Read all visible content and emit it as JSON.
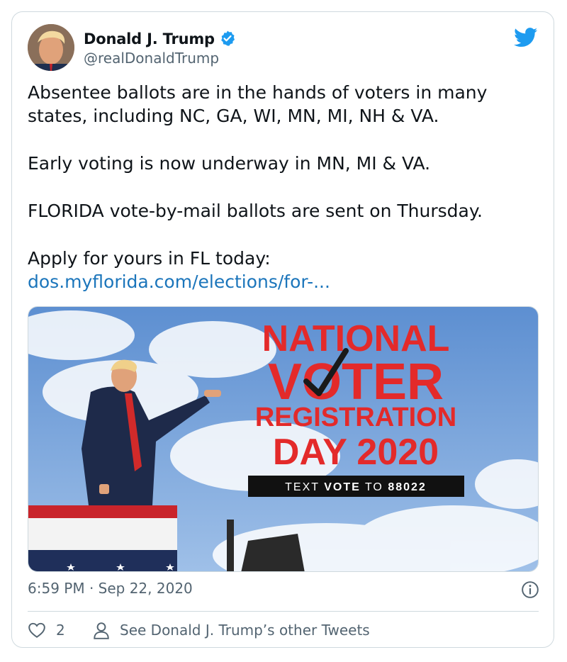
{
  "tweet": {
    "author_name": "Donald J. Trump",
    "author_handle": "@realDonaldTrump",
    "paragraphs": [
      "Absentee ballots are in the hands of voters in many states, including NC, GA, WI, MN, MI, NH & VA.",
      "Early voting is now underway in MN, MI & VA.",
      "FLORIDA vote-by-mail ballots are sent on Thursday.",
      "Apply for yours in FL today:"
    ],
    "link_text": "dos.myflorida.com/elections/for-...",
    "timestamp": "6:59 PM · Sep 22, 2020",
    "like_count": "2",
    "other_tweets_label": "See Donald J. Trump’s other Tweets"
  },
  "media": {
    "headline_1": "NATIONAL",
    "headline_2": "VOTER",
    "headline_3": "REGISTRATION",
    "headline_4": "DAY 2020",
    "cta_prefix": "TEXT",
    "cta_keyword": "VOTE",
    "cta_middle": "TO",
    "cta_number": "88022"
  },
  "colors": {
    "verified_blue": "#1d9bf0",
    "twitter_blue": "#1d9bf0",
    "link_blue": "#1b75bb",
    "headline_red": "#e32a2a",
    "muted_gray": "#536471"
  }
}
